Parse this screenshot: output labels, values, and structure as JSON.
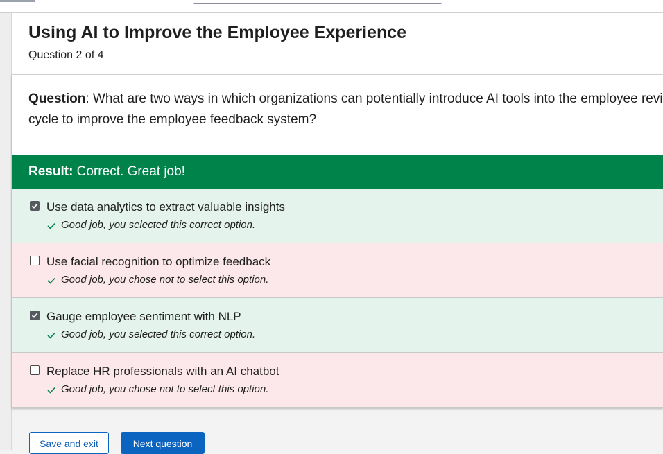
{
  "header": {
    "title": "Using AI to Improve the Employee Experience",
    "progress": "Question 2 of 4"
  },
  "question": {
    "prefix": "Question",
    "text": ": What are two ways in which organizations can potentially introduce AI tools into the employee review cycle to improve the employee feedback system?"
  },
  "result": {
    "prefix": "Result:",
    "text": " Correct. Great job!"
  },
  "options": [
    {
      "label": "Use data analytics to extract valuable insights",
      "checked": true,
      "status": "correct",
      "feedback": "Good job, you selected this correct option."
    },
    {
      "label": "Use facial recognition to optimize feedback",
      "checked": false,
      "status": "incorrect",
      "feedback": "Good job, you chose not to select this option."
    },
    {
      "label": "Gauge employee sentiment with NLP",
      "checked": true,
      "status": "correct",
      "feedback": "Good job, you selected this correct option."
    },
    {
      "label": "Replace HR professionals with an AI chatbot",
      "checked": false,
      "status": "incorrect",
      "feedback": "Good job, you chose not to select this option."
    }
  ],
  "buttons": {
    "save_exit": "Save and exit",
    "next": "Next question"
  },
  "colors": {
    "result_bar": "#00834a",
    "correct_bg": "#e4f3ec",
    "incorrect_bg": "#fce8ea",
    "primary": "#0b64c0"
  }
}
